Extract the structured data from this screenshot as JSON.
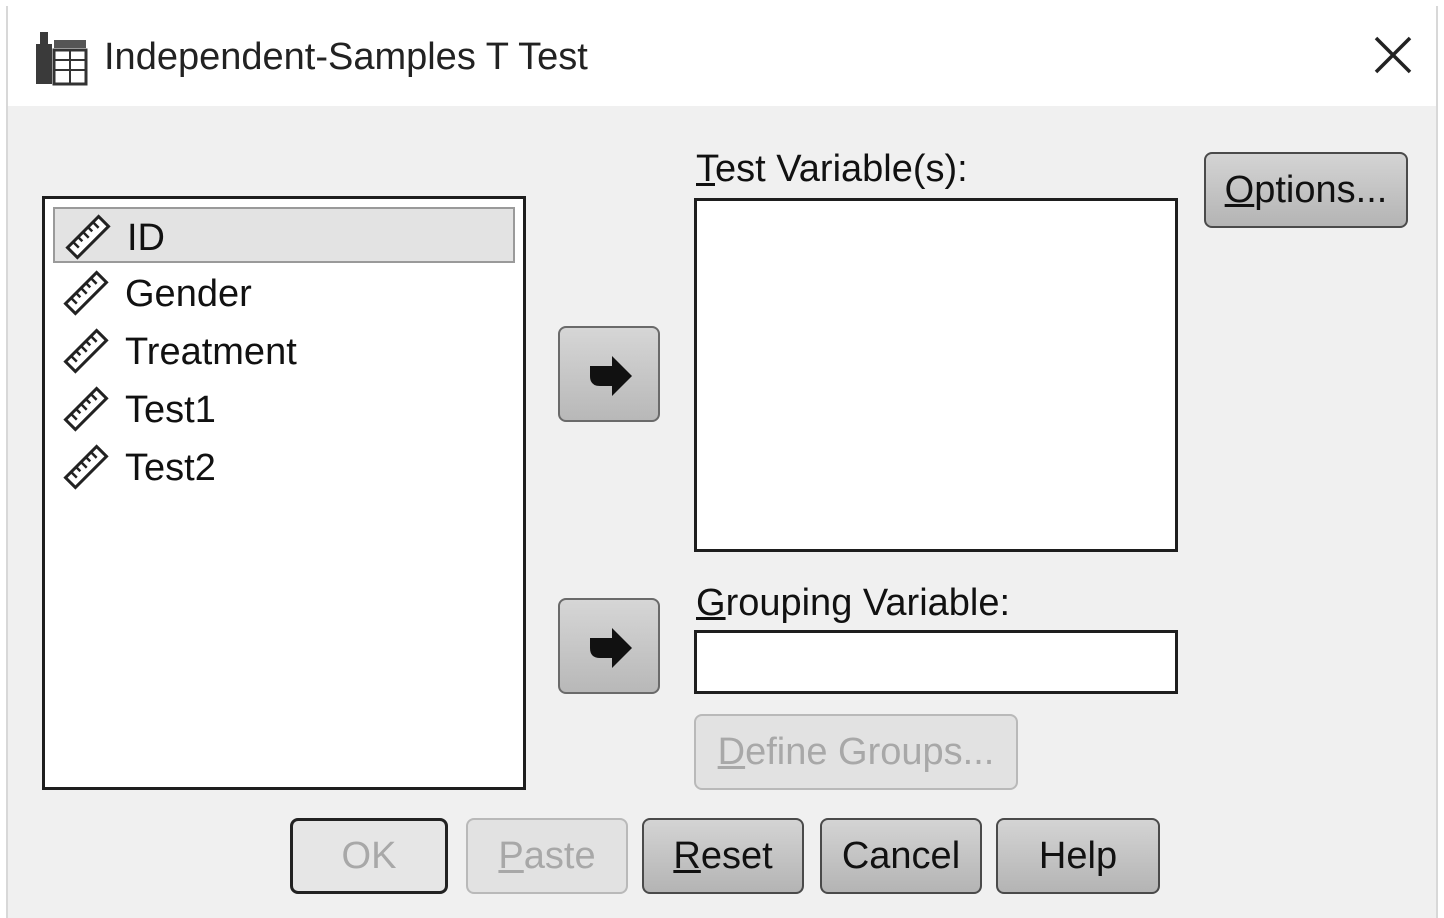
{
  "window": {
    "title": "Independent-Samples T Test",
    "title_icon": "t-test-dialog-icon",
    "close_icon": "close-icon"
  },
  "variables": [
    {
      "name": "ID",
      "icon": "scale-ruler-icon",
      "selected": true
    },
    {
      "name": "Gender",
      "icon": "scale-ruler-icon",
      "selected": false
    },
    {
      "name": "Treatment",
      "icon": "scale-ruler-icon",
      "selected": false
    },
    {
      "name": "Test1",
      "icon": "scale-ruler-icon",
      "selected": false
    },
    {
      "name": "Test2",
      "icon": "scale-ruler-icon",
      "selected": false
    }
  ],
  "test_variables": {
    "label_mnemonic": "T",
    "label_rest": "est Variable(s):",
    "items": []
  },
  "grouping_variable": {
    "label_mnemonic": "G",
    "label_rest": "rouping Variable:",
    "value": ""
  },
  "buttons": {
    "options": {
      "mnemonic": "O",
      "rest": "ptions...",
      "enabled": true
    },
    "define_groups": {
      "mnemonic": "D",
      "rest": "efine Groups...",
      "enabled": false
    },
    "ok": {
      "label": "OK",
      "enabled": false
    },
    "paste": {
      "mnemonic": "P",
      "rest": "aste",
      "enabled": false
    },
    "reset": {
      "mnemonic": "R",
      "rest": "eset",
      "enabled": true
    },
    "cancel": {
      "label": "Cancel",
      "enabled": true
    },
    "help": {
      "label": "Help",
      "enabled": true
    }
  }
}
